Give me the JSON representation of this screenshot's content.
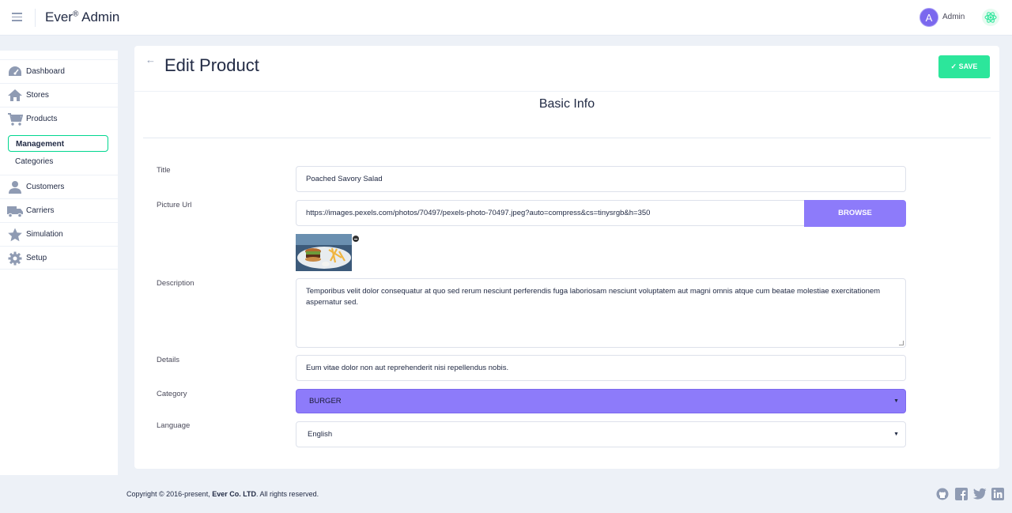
{
  "app": {
    "title": "Ever",
    "title_mark": "®",
    "title_suffix": " Admin",
    "user": {
      "initial": "A",
      "name": "Admin"
    }
  },
  "sidebar": {
    "items": [
      {
        "label": "Dashboard",
        "icon": "dashboard-icon"
      },
      {
        "label": "Stores",
        "icon": "home-icon"
      },
      {
        "label": "Products",
        "icon": "cart-icon"
      },
      {
        "label": "Customers",
        "icon": "person-icon"
      },
      {
        "label": "Carriers",
        "icon": "truck-icon"
      },
      {
        "label": "Simulation",
        "icon": "star-icon"
      },
      {
        "label": "Setup",
        "icon": "gear-icon"
      }
    ],
    "products_sub": [
      {
        "label": "Management",
        "active": true
      },
      {
        "label": "Categories",
        "active": false
      }
    ]
  },
  "page": {
    "title": "Edit Product",
    "save_label": "✓ SAVE",
    "section_title": "Basic Info"
  },
  "form": {
    "title_label": "Title",
    "title_value": "Poached Savory Salad",
    "picture_label": "Picture Url",
    "picture_value": "https://images.pexels.com/photos/70497/pexels-photo-70497.jpeg?auto=compress&cs=tinysrgb&h=350",
    "browse_label": "BROWSE",
    "description_label": "Description",
    "description_value": "Temporibus velit dolor consequatur at quo sed rerum nesciunt perferendis fuga laboriosam nesciunt voluptatem aut magni omnis atque cum beatae molestiae exercitationem aspernatur sed.",
    "details_label": "Details",
    "details_value": "Eum vitae dolor non aut reprehenderit nisi repellendus nobis.",
    "category_label": "Category",
    "category_value": "BURGER",
    "language_label": "Language",
    "language_value": "English"
  },
  "footer": {
    "copyright_prefix": "Copyright © 2016-present, ",
    "company": "Ever Co. LTD",
    "copyright_suffix": ". All rights reserved.",
    "social_icons": [
      "github-icon",
      "facebook-icon",
      "twitter-icon",
      "linkedin-icon"
    ]
  },
  "colors": {
    "accent": "#8d7bfa",
    "save": "#2ce69b",
    "active_border": "#00d68f",
    "background": "#edf1f7"
  }
}
